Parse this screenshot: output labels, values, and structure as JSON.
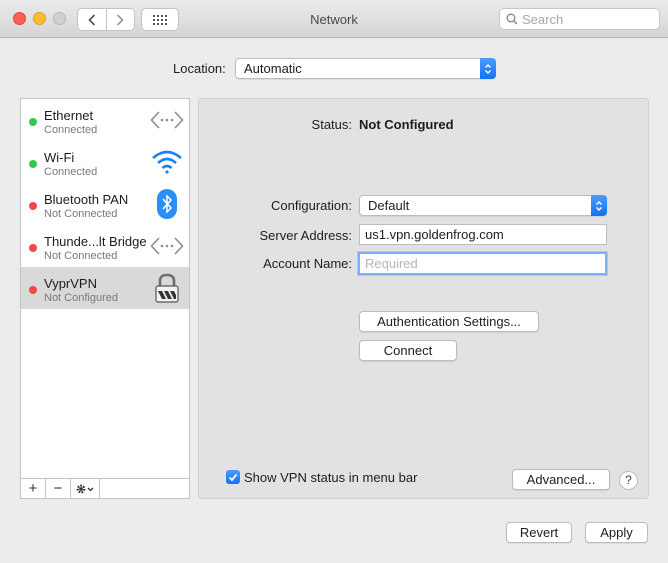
{
  "window": {
    "title": "Network"
  },
  "toolbar": {
    "search_placeholder": "Search"
  },
  "location": {
    "label": "Location:",
    "value": "Automatic"
  },
  "services": [
    {
      "name": "Ethernet",
      "status": "Connected",
      "status_color": "#34c84a",
      "icon": "ethernet-icon"
    },
    {
      "name": "Wi-Fi",
      "status": "Connected",
      "status_color": "#34c84a",
      "icon": "wifi-icon"
    },
    {
      "name": "Bluetooth PAN",
      "status": "Not Connected",
      "status_color": "#f0484a",
      "icon": "bluetooth-icon"
    },
    {
      "name": "Thunde...lt Bridge",
      "status": "Not Connected",
      "status_color": "#f0484a",
      "icon": "thunderbolt-bridge-icon"
    },
    {
      "name": "VyprVPN",
      "status": "Not Configured",
      "status_color": "#f0484a",
      "icon": "vpn-lock-icon",
      "selected": true
    }
  ],
  "sidebar_footer": {
    "add": "+",
    "remove": "−"
  },
  "detail": {
    "status_label": "Status:",
    "status_value": "Not Configured",
    "configuration_label": "Configuration:",
    "configuration_value": "Default",
    "server_address_label": "Server Address:",
    "server_address_value": "us1.vpn.goldenfrog.com",
    "account_name_label": "Account Name:",
    "account_name_placeholder": "Required",
    "auth_settings_button": "Authentication Settings...",
    "connect_button": "Connect",
    "show_vpn_status_label": "Show VPN status in menu bar",
    "show_vpn_status_checked": true,
    "advanced_button": "Advanced...",
    "help_button": "?"
  },
  "footer": {
    "revert_button": "Revert",
    "apply_button": "Apply"
  },
  "colors": {
    "accent": "#1a73f5",
    "connected": "#34c84a",
    "disconnected": "#f0484a"
  }
}
